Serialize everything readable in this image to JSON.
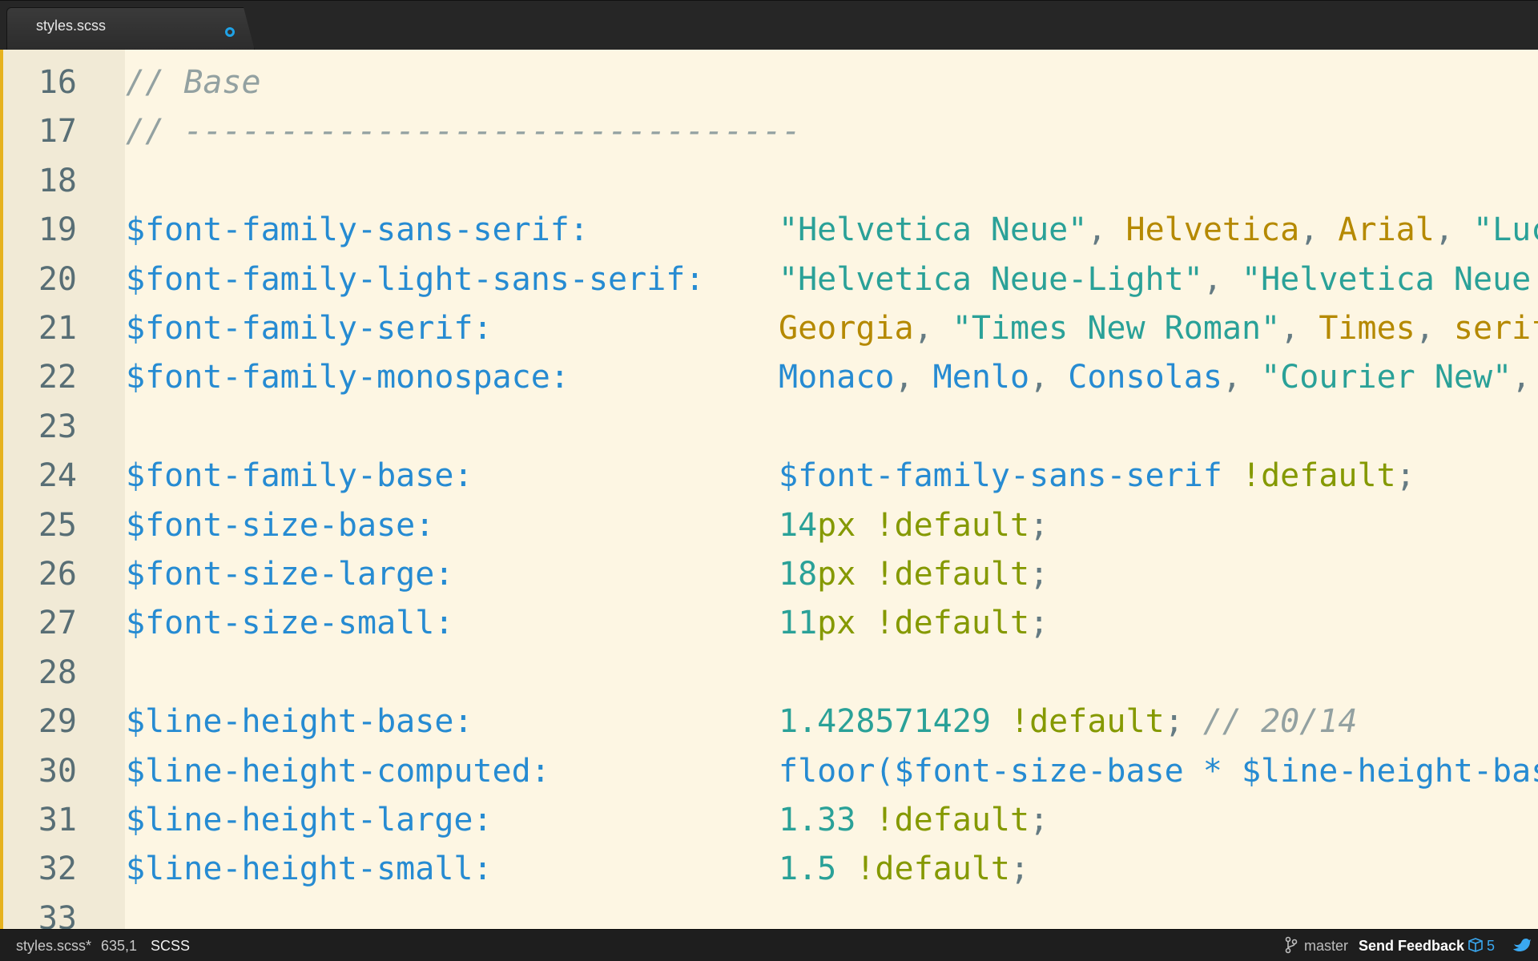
{
  "tab": {
    "label": "styles.scss"
  },
  "lines": [
    {
      "n": "16",
      "seg": [
        {
          "t": "// Base",
          "c": "cmt"
        }
      ],
      "val": []
    },
    {
      "n": "17",
      "seg": [
        {
          "t": "// --------------------------------",
          "c": "cmt"
        }
      ],
      "val": []
    },
    {
      "n": "18",
      "seg": [],
      "val": []
    },
    {
      "n": "19",
      "seg": [
        {
          "t": "$font-family-sans-serif:",
          "c": "var"
        }
      ],
      "val": [
        {
          "t": "\"Helvetica Neue\"",
          "c": "str"
        },
        {
          "t": ", ",
          "c": "punc"
        },
        {
          "t": "Helvetica",
          "c": "font"
        },
        {
          "t": ", ",
          "c": "punc"
        },
        {
          "t": "Arial",
          "c": "font"
        },
        {
          "t": ", ",
          "c": "punc"
        },
        {
          "t": "\"Luc",
          "c": "str"
        }
      ]
    },
    {
      "n": "20",
      "seg": [
        {
          "t": "$font-family-light-sans-serif:",
          "c": "var"
        }
      ],
      "val": [
        {
          "t": "\"Helvetica Neue-Light\"",
          "c": "str"
        },
        {
          "t": ", ",
          "c": "punc"
        },
        {
          "t": "\"Helvetica Neue",
          "c": "str"
        }
      ]
    },
    {
      "n": "21",
      "seg": [
        {
          "t": "$font-family-serif:",
          "c": "var"
        }
      ],
      "val": [
        {
          "t": "Georgia",
          "c": "font"
        },
        {
          "t": ", ",
          "c": "punc"
        },
        {
          "t": "\"Times New Roman\"",
          "c": "str"
        },
        {
          "t": ", ",
          "c": "punc"
        },
        {
          "t": "Times",
          "c": "font"
        },
        {
          "t": ", ",
          "c": "punc"
        },
        {
          "t": "serif",
          "c": "font"
        }
      ]
    },
    {
      "n": "22",
      "seg": [
        {
          "t": "$font-family-monospace:",
          "c": "var"
        }
      ],
      "val": [
        {
          "t": "Monaco",
          "c": "var"
        },
        {
          "t": ", ",
          "c": "punc"
        },
        {
          "t": "Menlo",
          "c": "var"
        },
        {
          "t": ", ",
          "c": "punc"
        },
        {
          "t": "Consolas",
          "c": "var"
        },
        {
          "t": ", ",
          "c": "punc"
        },
        {
          "t": "\"Courier New\"",
          "c": "str"
        },
        {
          "t": ",",
          "c": "punc"
        }
      ]
    },
    {
      "n": "23",
      "seg": [],
      "val": []
    },
    {
      "n": "24",
      "seg": [
        {
          "t": "$font-family-base:",
          "c": "var"
        }
      ],
      "val": [
        {
          "t": "$font-family-sans-serif",
          "c": "var"
        },
        {
          "t": " ",
          "c": "punc"
        },
        {
          "t": "!default",
          "c": "kw"
        },
        {
          "t": ";",
          "c": "punc"
        }
      ]
    },
    {
      "n": "25",
      "seg": [
        {
          "t": "$font-size-base:",
          "c": "var"
        }
      ],
      "val": [
        {
          "t": "14",
          "c": "num"
        },
        {
          "t": "px !default",
          "c": "kw"
        },
        {
          "t": ";",
          "c": "punc"
        }
      ]
    },
    {
      "n": "26",
      "seg": [
        {
          "t": "$font-size-large:",
          "c": "var"
        }
      ],
      "val": [
        {
          "t": "18",
          "c": "num"
        },
        {
          "t": "px !default",
          "c": "kw"
        },
        {
          "t": ";",
          "c": "punc"
        }
      ]
    },
    {
      "n": "27",
      "seg": [
        {
          "t": "$font-size-small:",
          "c": "var"
        }
      ],
      "val": [
        {
          "t": "11",
          "c": "num"
        },
        {
          "t": "px !default",
          "c": "kw"
        },
        {
          "t": ";",
          "c": "punc"
        }
      ]
    },
    {
      "n": "28",
      "seg": [],
      "val": []
    },
    {
      "n": "29",
      "seg": [
        {
          "t": "$line-height-base:",
          "c": "var"
        }
      ],
      "val": [
        {
          "t": "1.428571429",
          "c": "num"
        },
        {
          "t": " ",
          "c": "punc"
        },
        {
          "t": "!default",
          "c": "kw"
        },
        {
          "t": "; ",
          "c": "punc"
        },
        {
          "t": "// 20/14",
          "c": "cmt"
        }
      ]
    },
    {
      "n": "30",
      "seg": [
        {
          "t": "$line-height-computed:",
          "c": "var"
        }
      ],
      "val": [
        {
          "t": "floor($font-size-base * $line-height-bas",
          "c": "var"
        }
      ]
    },
    {
      "n": "31",
      "seg": [
        {
          "t": "$line-height-large:",
          "c": "var"
        }
      ],
      "val": [
        {
          "t": "1.33",
          "c": "num"
        },
        {
          "t": " ",
          "c": "punc"
        },
        {
          "t": "!default",
          "c": "kw"
        },
        {
          "t": ";",
          "c": "punc"
        }
      ]
    },
    {
      "n": "32",
      "seg": [
        {
          "t": "$line-height-small:",
          "c": "var"
        }
      ],
      "val": [
        {
          "t": "1.5",
          "c": "num"
        },
        {
          "t": " ",
          "c": "punc"
        },
        {
          "t": "!default",
          "c": "kw"
        },
        {
          "t": ";",
          "c": "punc"
        }
      ]
    },
    {
      "n": "33",
      "seg": [],
      "val": []
    }
  ],
  "status": {
    "file": "styles.scss*",
    "position": "635,1",
    "syntax": "SCSS",
    "branch": "master",
    "feedback": "Send Feedback",
    "packages": "5"
  },
  "colors": {
    "accent": "#1fa2e6",
    "gutter_marker": "#e6b21e",
    "background": "#fdf6e3"
  },
  "icons": [
    "tab-dirty-indicator-icon",
    "git-branch-icon",
    "package-icon",
    "bird-icon"
  ]
}
